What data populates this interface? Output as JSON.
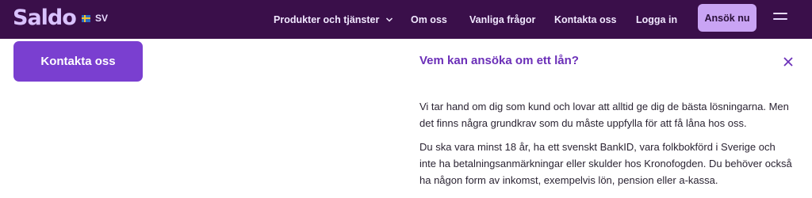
{
  "header": {
    "logo": "Saldo",
    "language": "SV",
    "nav": [
      "Produkter och tjänster",
      "Om oss",
      "Vanliga frågor",
      "Kontakta oss",
      "Logga in"
    ],
    "apply_label": "Ansök nu"
  },
  "main": {
    "contact_label": "Kontakta oss",
    "faq": {
      "question": "Vem kan ansöka om ett lån?",
      "paragraphs": [
        "Vi tar hand om dig som kund och lovar att alltid ge dig de bästa lösningarna. Men det finns några grundkrav som du måste uppfylla för att få låna hos oss.",
        "Du ska vara minst 18 år, ha ett svenskt BankID, vara folkbokförd i Sverige och inte ha betalningsanmärkningar eller skulder hos Kronofogden. Du behöver också ha någon form av inkomst, exempelvis lön, pension eller a-kassa."
      ]
    }
  },
  "icons": {
    "flag": "sweden-flag-icon",
    "chevron": "chevron-down-icon",
    "menu": "hamburger-menu-icon",
    "close": "close-icon"
  },
  "colors": {
    "header_bg": "#3a0f4a",
    "accent": "#7a3fd0",
    "apply_bg": "#c9a4f4",
    "question": "#6b2fb8"
  }
}
